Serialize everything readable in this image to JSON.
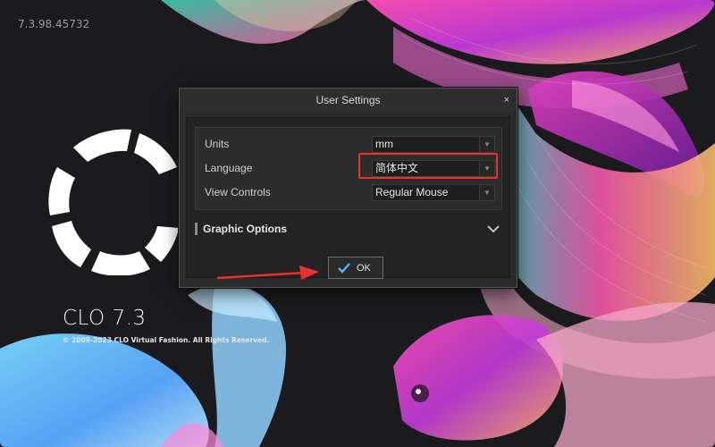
{
  "splash": {
    "version": "7.3.98.45732",
    "product_name": "CLO 7.3",
    "copyright": "© 2009-2023 CLO Virtual Fashion. All Rights Reserved."
  },
  "dialog": {
    "title": "User Settings",
    "close_label": "×",
    "settings": [
      {
        "label": "Units",
        "value": "mm"
      },
      {
        "label": "Language",
        "value": "简体中文"
      },
      {
        "label": "View Controls",
        "value": "Regular Mouse"
      }
    ],
    "graphic_options_label": "Graphic Options",
    "ok_label": "OK"
  },
  "colors": {
    "annotation_red": "#e8322b",
    "check_blue": "#5ab4f0"
  }
}
